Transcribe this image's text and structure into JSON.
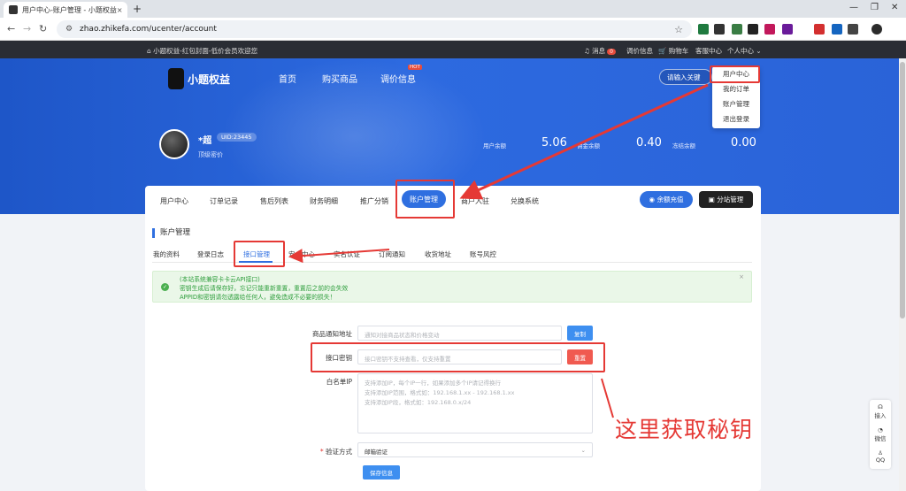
{
  "browser": {
    "tab_title": "用户中心-账户管理 - 小题权益",
    "tab_close": "×",
    "new_tab": "+",
    "url": "zhao.zhikefa.com/ucenter/account",
    "win_min": "—",
    "win_max": "❐",
    "win_close": "✕"
  },
  "topbar": {
    "slogan": "小题权益-红包封面-低价会员欢迎您",
    "messages": "消息",
    "message_count": "0",
    "price_info": "调价信息",
    "cart": "购物车",
    "service": "客服中心",
    "user_center": "个人中心"
  },
  "header": {
    "logo_text": "小题权益",
    "nav": [
      "首页",
      "购买商品",
      "调价信息"
    ],
    "hot_badge": "HOT",
    "search_btn": "请输入关键"
  },
  "user_dropdown": [
    "用户中心",
    "我的订单",
    "账户管理",
    "退出登录"
  ],
  "profile": {
    "name": "*超",
    "uid": "UID:23445",
    "level": "顶级密价",
    "stats": [
      {
        "label": "用户余额",
        "value": "5.06"
      },
      {
        "label": "佣金余额",
        "value": "0.40"
      },
      {
        "label": "冻结余额",
        "value": "0.00"
      }
    ]
  },
  "main_tabs": [
    "用户中心",
    "订单记录",
    "售后列表",
    "财务明细",
    "推广分销",
    "账户管理",
    "商户入驻",
    "兑换系统"
  ],
  "buttons": {
    "recharge": "余额充值",
    "substation": "分站管理"
  },
  "section_title": "账户管理",
  "sub_tabs": [
    "我的资料",
    "登录日志",
    "接口管理",
    "安全中心",
    "实名认证",
    "订阅通知",
    "收货地址",
    "账号风控"
  ],
  "alert": {
    "line1": "(本站系统兼容卡卡云API接口)",
    "line2": "密钥生成后请保存好，忘记只能重新重置，重置后之前的会失效",
    "line3": "APPID和密钥请勿透露给任何人，避免造成不必要的损失！",
    "close": "×"
  },
  "form": {
    "notify_label": "商品通知地址",
    "notify_placeholder": "通知对接商品状态和价格变动",
    "copy_btn": "复制",
    "key_label": "接口密钥",
    "key_placeholder": "接口密钥不支持查看，仅支持重置",
    "reset_btn": "重置",
    "whitelist_label": "白名单IP",
    "whitelist_lines": [
      "支持添加IP，每个IP一行，如果添加多个IP请记得换行",
      "支持添加IP范围，格式如：192.168.1.xx - 192.168.1.xx",
      "支持添加IP段，格式如：192.168.0.x/24"
    ],
    "verify_label": "验证方式",
    "verify_required": "*",
    "verify_value": "邮箱验证",
    "save_btn": "保存信息"
  },
  "annotation": "这里获取秘钥",
  "side_widget": [
    "接入",
    "微信",
    "QQ"
  ],
  "colors": {
    "primary": "#2f6fe0",
    "annotation": "#e53935",
    "success": "#2e9e3c",
    "reset": "#f05a50"
  }
}
